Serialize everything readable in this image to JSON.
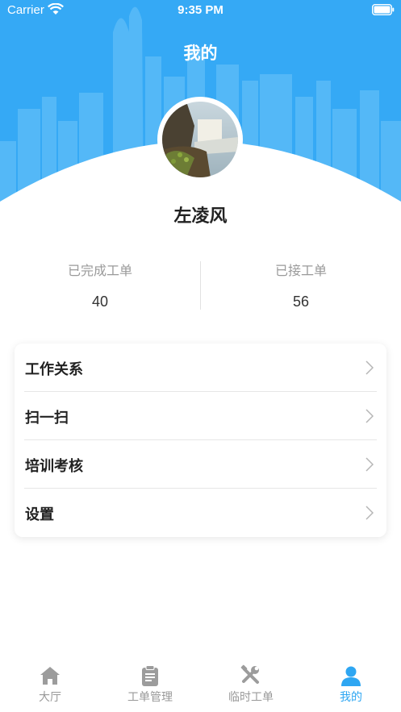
{
  "status_bar": {
    "carrier": "Carrier",
    "time": "9:35 PM"
  },
  "nav": {
    "title": "我的"
  },
  "profile": {
    "name": "左凌风"
  },
  "stats": {
    "completed_label": "已完成工单",
    "completed_value": "40",
    "accepted_label": "已接工单",
    "accepted_value": "56"
  },
  "menu": {
    "items": [
      {
        "label": "工作关系"
      },
      {
        "label": "扫一扫"
      },
      {
        "label": "培训考核"
      },
      {
        "label": "设置"
      }
    ]
  },
  "tabbar": {
    "items": [
      {
        "label": "大厅",
        "icon": "home-icon"
      },
      {
        "label": "工单管理",
        "icon": "clipboard-icon"
      },
      {
        "label": "临时工单",
        "icon": "tools-icon"
      },
      {
        "label": "我的",
        "icon": "person-icon"
      }
    ],
    "active_index": 3
  },
  "colors": {
    "accent": "#2ea6f2",
    "header_blue": "#35a9f5"
  }
}
